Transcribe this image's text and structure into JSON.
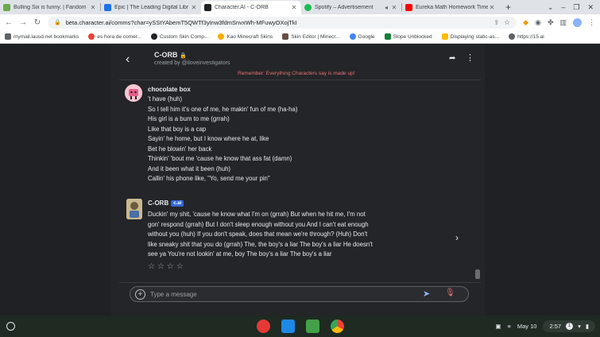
{
  "browser": {
    "tabs": [
      {
        "title": "Bulling Six is funny. | Fandom",
        "favicon_color": "#6aa84f",
        "active": false
      },
      {
        "title": "Epic | The Leading Digital Libr",
        "favicon_color": "#1a73e8",
        "active": false
      },
      {
        "title": "Character.AI - C-ORB",
        "favicon_color": "#202124",
        "active": true
      },
      {
        "title": "Spotify – Advertisement",
        "favicon_color": "#1db954",
        "active": false
      },
      {
        "title": "Eureka Math Homework Time",
        "favicon_color": "#ff0000",
        "active": false
      }
    ],
    "new_tab_icon": "plus-icon",
    "url": "beta.character.ai/comms?char=ySStYAbemT5QWTf3yInw3fdmSnvxWh-MFuwyOXojTkI",
    "bookmarks": [
      {
        "label": "mymail.lausd.net bookmarks",
        "color": "#5f6368"
      },
      {
        "label": "es hora de comer...",
        "color": "#ea4335"
      },
      {
        "label": "Custom Skin Comp...",
        "color": "#202124"
      },
      {
        "label": "Kao Minecraft Skins",
        "color": "#f9ab00"
      },
      {
        "label": "Skin Editor | Minecr...",
        "color": "#6d4c41"
      },
      {
        "label": "Google",
        "color": "#4285f4"
      },
      {
        "label": "Slope Unblocked",
        "color": "#188038"
      },
      {
        "label": "Displaying static-as...",
        "color": "#fbbc04"
      },
      {
        "label": "https://15.ai",
        "color": "#5f6368"
      }
    ]
  },
  "chat": {
    "character_name": "C-ORB",
    "creator": "created by @iloveinvestigators",
    "disclaimer": "Remember: Everything Characters say is made up!",
    "user_message": {
      "name": "chocolate box",
      "lines": [
        "'t have (huh)",
        "So I tell him it's one of me, he makin' fun of me (ha-ha)",
        "His girl is a bum to me (grrah)",
        "Like that boy is a cap",
        "Sayin' he home, but I know where he at, like",
        "Bet he blowin' her back",
        "Thinkin' 'bout me 'cause he know that ass fat (damn)",
        "And it been what it been (huh)",
        "Callin' his phone like, \"Yo, send me your pin\""
      ]
    },
    "bot_message": {
      "name": "C-ORB",
      "badge": "c.ai",
      "lines": [
        "Duckin' my shit, 'cause he know what I'm on (grrah) But when he hit me, I'm not",
        "gon' respond (grrah) But I don't sleep enough without you And I can't eat enough",
        "without you (huh) If you don't speak, does that mean we're through? (Huh) Don't",
        "like sneaky shit that you do (grrah) The, the boy's a liar The boy's a liar He doesn't",
        "see ya You're not lookin' at me, boy The boy's a liar The boy's a liar"
      ],
      "rating_stars": "☆☆☆☆"
    },
    "composer": {
      "placeholder": "Type a message"
    }
  },
  "shelf": {
    "date": "May 10",
    "time": "2:57",
    "notification_count": "1"
  }
}
